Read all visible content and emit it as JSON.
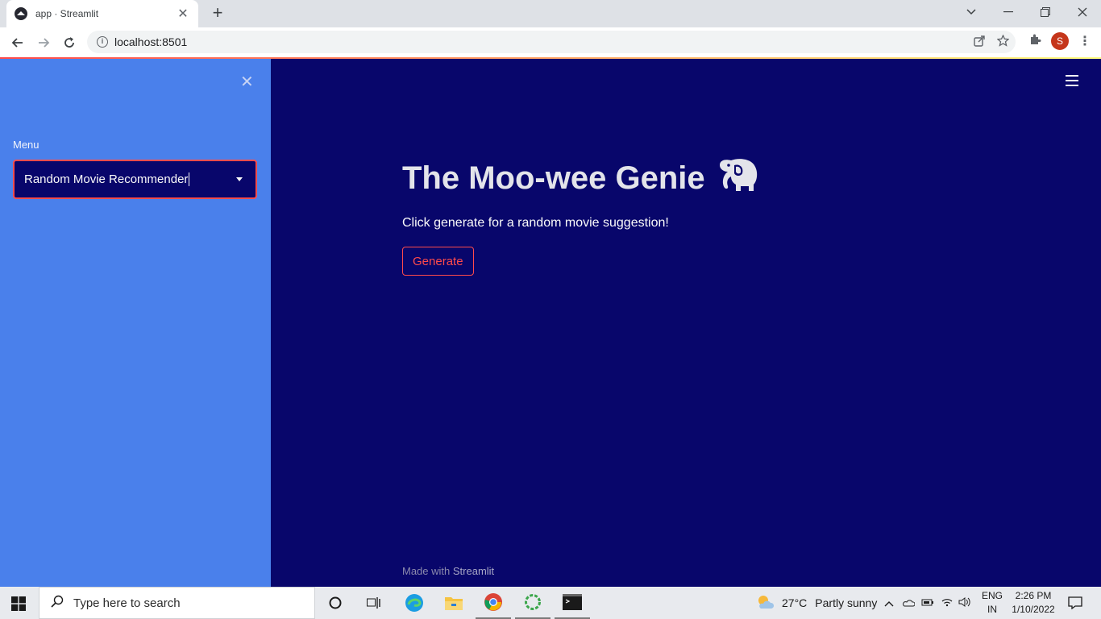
{
  "browser": {
    "tab_title": "app · Streamlit",
    "url": "localhost:8501",
    "profile_initial": "S"
  },
  "sidebar": {
    "label": "Menu",
    "select_value": "Random Movie Recommender"
  },
  "main": {
    "title": "The Moo-wee Genie",
    "title_icon": "elephant-icon",
    "subtitle": "Click generate for a random movie suggestion!",
    "generate_label": "Generate",
    "footer_prefix": "Made with",
    "footer_brand": "Streamlit"
  },
  "taskbar": {
    "search_placeholder": "Type here to search",
    "weather_temp": "27°C",
    "weather_desc": "Partly sunny",
    "lang_1": "ENG",
    "lang_2": "IN",
    "time": "2:26 PM",
    "date": "1/10/2022"
  },
  "colors": {
    "sidebar_bg": "#4a80eb",
    "main_bg": "#08066b",
    "accent": "#ff4b4b"
  }
}
